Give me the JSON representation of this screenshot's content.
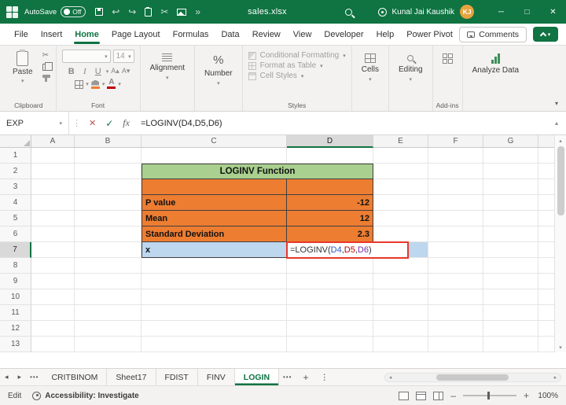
{
  "app": {
    "accent": "#107C41",
    "titlebar_color": "#0F7342"
  },
  "title_bar": {
    "autosave_label": "AutoSave",
    "autosave_state": "Off",
    "filename": "sales.xlsx",
    "user_name": "Kunal Jai Kaushik",
    "user_initials": "KJ"
  },
  "menu": {
    "tabs": [
      "File",
      "Insert",
      "Home",
      "Page Layout",
      "Formulas",
      "Data",
      "Review",
      "View",
      "Developer",
      "Help",
      "Power Pivot"
    ],
    "active_tab": "Home",
    "comments_label": "Comments"
  },
  "ribbon": {
    "clipboard": {
      "label": "Clipboard",
      "paste_label": "Paste"
    },
    "font": {
      "label": "Font",
      "size": "14",
      "bold": "B",
      "italic": "I",
      "underline": "U"
    },
    "alignment": {
      "label": "Alignment"
    },
    "number": {
      "label": "Number",
      "percent": "%"
    },
    "styles": {
      "label": "Styles",
      "items": [
        "Conditional Formatting",
        "Format as Table",
        "Cell Styles"
      ]
    },
    "cells": {
      "label": "Cells"
    },
    "editing": {
      "label": "Editing"
    },
    "addins": {
      "label": "Add-ins"
    },
    "analyze": {
      "label": "Analyze Data"
    }
  },
  "formula_bar": {
    "name_box": "EXP",
    "formula": "=LOGINV(D4,D5,D6)"
  },
  "sheet": {
    "columns": [
      "A",
      "B",
      "C",
      "D",
      "E",
      "F",
      "G"
    ],
    "rows": [
      "1",
      "2",
      "3",
      "4",
      "5",
      "6",
      "7",
      "8",
      "9",
      "10",
      "11",
      "12",
      "13"
    ],
    "title": "LOGINV Function",
    "entries": [
      {
        "label": "P value",
        "value": "-12"
      },
      {
        "label": "Mean",
        "value": "12"
      },
      {
        "label": "Standard Deviation",
        "value": "2.3"
      }
    ],
    "x_label": "x",
    "formula": {
      "prefix": "=LOGINV(",
      "ref1": "D4",
      "sep1": ",",
      "ref2": "D5",
      "sep2": ",",
      "ref3": "D6",
      "suffix": ")"
    },
    "colors": {
      "title_fill": "#A9D08E",
      "data_fill": "#ED7D31",
      "x_fill": "#BDD7EE",
      "ref1": "#2B57C5",
      "ref2": "#C00000",
      "ref3": "#7030A0",
      "edit_border": "#E8372C"
    }
  },
  "sheet_tabs": {
    "tabs": [
      "CRITBINOM",
      "Sheet17",
      "FDIST",
      "FINV",
      "LOGIN"
    ],
    "active": "LOGIN"
  },
  "status_bar": {
    "mode": "Edit",
    "accessibility": "Accessibility: Investigate",
    "zoom": "100%"
  }
}
